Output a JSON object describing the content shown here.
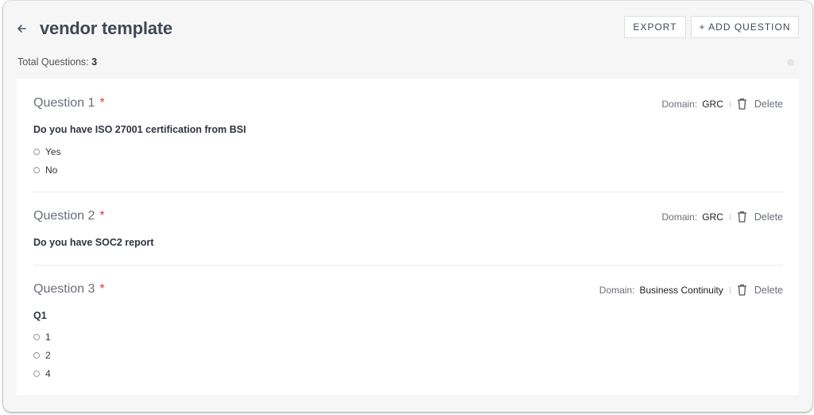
{
  "header": {
    "title": "vendor template",
    "back_icon": "arrow-left-icon",
    "export_label": "EXPORT",
    "add_question_label": "+ ADD QUESTION"
  },
  "summary": {
    "total_label": "Total Questions:",
    "total_count": "3"
  },
  "questions": [
    {
      "title": "Question 1",
      "required_mark": "*",
      "domain_label": "Domain:",
      "domain_value": "GRC",
      "delete_label": "Delete",
      "text": "Do you have ISO 27001 certification from BSI",
      "options": [
        "Yes",
        "No"
      ]
    },
    {
      "title": "Question 2",
      "required_mark": "*",
      "domain_label": "Domain:",
      "domain_value": "GRC",
      "delete_label": "Delete",
      "text": "Do you have SOC2 report",
      "options": []
    },
    {
      "title": "Question 3",
      "required_mark": "*",
      "domain_label": "Domain:",
      "domain_value": "Business Continuity",
      "delete_label": "Delete",
      "text": "Q1",
      "options": [
        "1",
        "2",
        "4"
      ]
    }
  ],
  "colors": {
    "required": "#e03c3c",
    "title": "#3f4858",
    "background": "#f6f6f7"
  }
}
